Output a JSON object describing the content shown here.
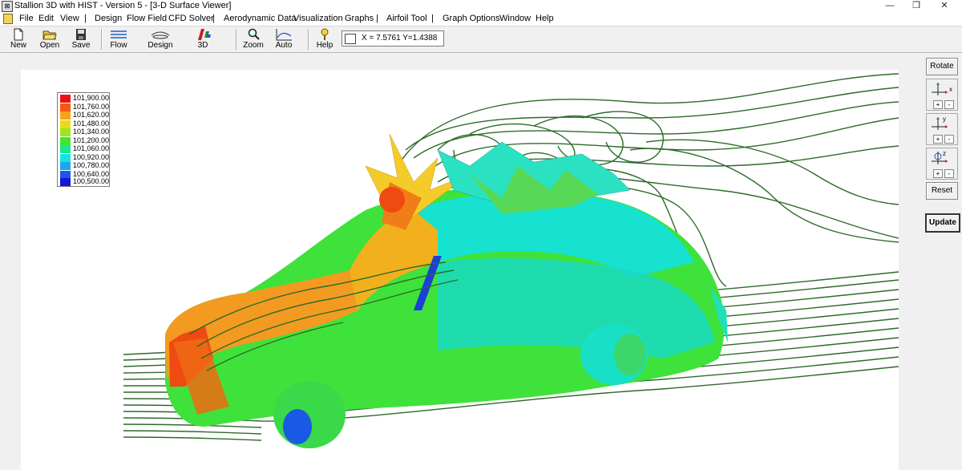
{
  "window": {
    "title": "Stallion 3D with HIST - Version 5 - [3-D Surface Viewer]",
    "app_icon": "stallion-app-icon",
    "controls": [
      "minimize",
      "restore",
      "close"
    ]
  },
  "menu": {
    "items": [
      "File",
      "Edit",
      "View",
      "|",
      "Design",
      "Flow Field",
      "CFD Solver",
      "|",
      "Aerodynamic Data",
      "Visualization",
      "Graphs",
      "|",
      "Airfoil Tool",
      "|",
      "Graph Options",
      "Window",
      "Help"
    ]
  },
  "toolbar": {
    "new": "New",
    "open": "Open",
    "save": "Save",
    "flow": "Flow",
    "design": "Design",
    "three_d": "3D",
    "zoom": "Zoom",
    "auto": "Auto",
    "help": "Help",
    "coords": "X = 7.5761  Y=1.4388"
  },
  "legend": {
    "entries": [
      {
        "value": "101,900.00",
        "color": "#ee1111"
      },
      {
        "value": "101,760.00",
        "color": "#f25a10"
      },
      {
        "value": "101,620.00",
        "color": "#f7a11a"
      },
      {
        "value": "101,480.00",
        "color": "#e8dc1a"
      },
      {
        "value": "101,340.00",
        "color": "#9fe51d"
      },
      {
        "value": "101,200.00",
        "color": "#3ee62c"
      },
      {
        "value": "101,060.00",
        "color": "#19e88c"
      },
      {
        "value": "100,920.00",
        "color": "#14e4dd"
      },
      {
        "value": "100,780.00",
        "color": "#1aa6f0"
      },
      {
        "value": "100,640.00",
        "color": "#1d56ee"
      },
      {
        "value": "100,500.00",
        "color": "#1616d6"
      }
    ]
  },
  "side": {
    "rotate": "Rotate",
    "axis_x": "x",
    "axis_y": "y",
    "axis_z": "z",
    "plus": "+",
    "minus": "-",
    "reset": "Reset",
    "update": "Update"
  },
  "colors": {
    "streamline": "#2e6b2a",
    "background": "#f0f0f0",
    "viewer": "#ffffff"
  }
}
